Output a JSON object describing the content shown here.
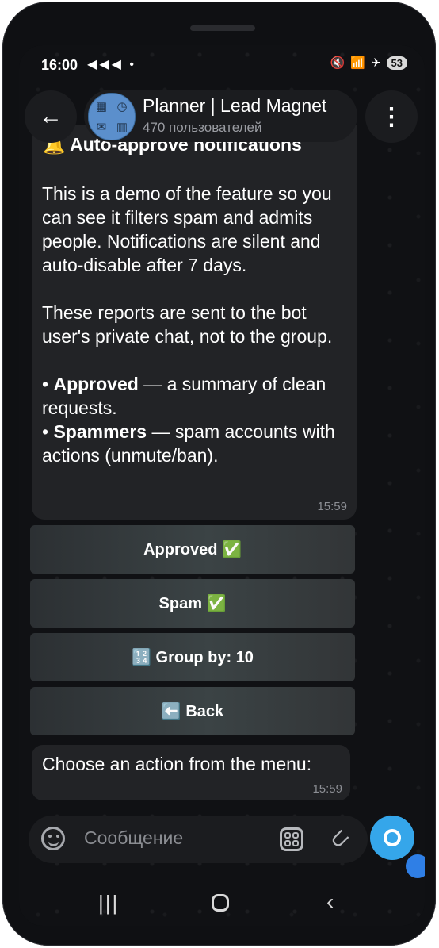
{
  "status_bar": {
    "time": "16:00",
    "left_icons": "◀◀◀ •",
    "battery": "53"
  },
  "header": {
    "title": "Planner | Lead Magnet",
    "members": "470 пользователей"
  },
  "message": {
    "heading": "🔔 Auto-approve notifications",
    "paragraph1": "This is a demo of the feature so you can see it filters spam and admits people. Notifications are silent and auto-disable after 7 days.",
    "paragraph2": "These reports are sent to the bot user's private chat, not to the group.",
    "bullet1_bold": "Approved",
    "bullet1_rest": " — a summary of clean requests.",
    "bullet2_bold": "Spammers",
    "bullet2_rest": " — spam accounts with actions (unmute/ban).",
    "time": "15:59"
  },
  "keyboard": {
    "approved": "Approved ✅",
    "spam": "Spam ✅",
    "group_by": "🔢 Group by: 10",
    "back": "⬅️ Back"
  },
  "message2": {
    "text": "Choose an action from the menu:",
    "time": "15:59"
  },
  "composer": {
    "placeholder": "Сообщение"
  }
}
